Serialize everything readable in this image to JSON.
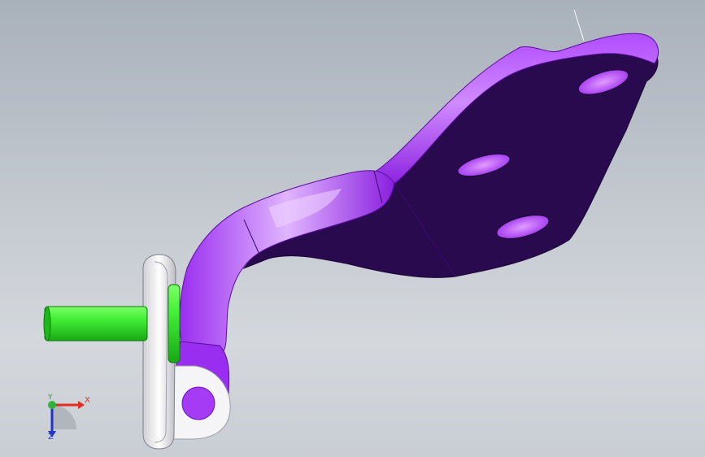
{
  "viewport": {
    "colors": {
      "background_top": "#a9b1bb",
      "background_bottom": "#d4d8dd",
      "bracket_purple": "#9a2ef0",
      "bracket_dark_face": "#2a0a4f",
      "pin_green": "#2fe02a",
      "washer_white": "#f2f2f2"
    }
  },
  "triad": {
    "x_label": "X",
    "y_label": "Y",
    "z_label": "Z",
    "x_color": "#e32b1e",
    "y_color": "#2fb33a",
    "z_color": "#2234c8"
  }
}
